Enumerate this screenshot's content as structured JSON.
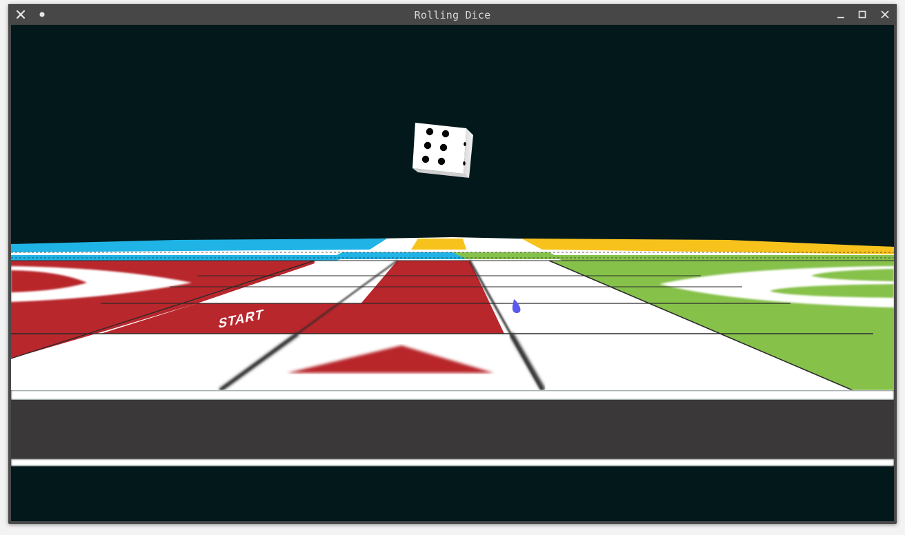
{
  "window": {
    "title": "Rolling Dice"
  },
  "titlebar": {
    "close_icon": "close-icon",
    "pin_icon": "dot-icon",
    "minimize_icon": "minimize-icon",
    "maximize_icon": "maximize-icon",
    "window_close_icon": "close-icon"
  },
  "scene": {
    "background_color": "#02181a",
    "board": {
      "start_label": "START",
      "colors": {
        "red": "#b8272c",
        "green": "#86c14a",
        "blue": "#1fb3e6",
        "yellow": "#f7c21c",
        "white": "#ffffff",
        "edge": "#3a3839"
      }
    },
    "dice": {
      "top_face_value": 6
    },
    "token": {
      "color": "#5a5af0"
    }
  }
}
